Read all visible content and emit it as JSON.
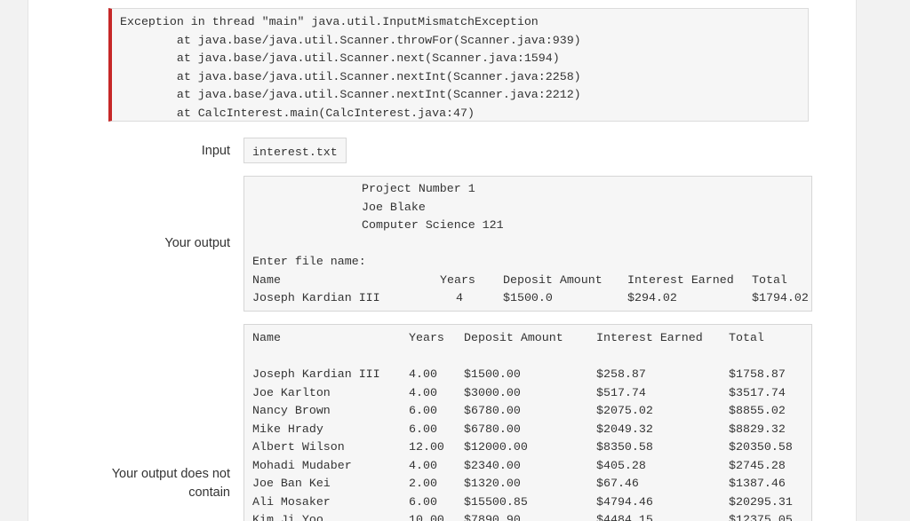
{
  "error": {
    "lines": [
      "Exception in thread \"main\" java.util.InputMismatchException",
      "        at java.base/java.util.Scanner.throwFor(Scanner.java:939)",
      "        at java.base/java.util.Scanner.next(Scanner.java:1594)",
      "        at java.base/java.util.Scanner.nextInt(Scanner.java:2258)",
      "        at java.base/java.util.Scanner.nextInt(Scanner.java:2212)",
      "        at CalcInterest.main(CalcInterest.java:47)"
    ],
    "accent_color": "#c62828"
  },
  "input": {
    "label": "Input",
    "value": "interest.txt"
  },
  "your_output": {
    "label": "Your output",
    "header_lines": [
      "Project Number 1",
      "Joe Blake",
      "Computer Science 121"
    ],
    "prompt": "Enter file name:",
    "table": {
      "columns": [
        "Name",
        "Years",
        "Deposit Amount",
        "Interest Earned",
        "Total"
      ],
      "rows": [
        [
          "Joseph Kardian III",
          "4",
          "$1500.0",
          "$294.02",
          "$1794.02"
        ]
      ]
    }
  },
  "expected_missing": {
    "label": "Your output does not contain",
    "columns": [
      "Name",
      "Years",
      "Deposit Amount",
      "Interest Earned",
      "Total"
    ],
    "rows": [
      [
        "Joseph Kardian III",
        "4.00",
        "$1500.00",
        "$258.87",
        "$1758.87"
      ],
      [
        "Joe Karlton",
        "4.00",
        "$3000.00",
        "$517.74",
        "$3517.74"
      ],
      [
        "Nancy Brown",
        "6.00",
        "$6780.00",
        "$2075.02",
        "$8855.02"
      ],
      [
        "Mike Hrady",
        "6.00",
        "$6780.00",
        "$2049.32",
        "$8829.32"
      ],
      [
        "Albert Wilson",
        "12.00",
        "$12000.00",
        "$8350.58",
        "$20350.58"
      ],
      [
        "Mohadi Mudaber",
        "4.00",
        "$2340.00",
        "$405.28",
        "$2745.28"
      ],
      [
        "Joe Ban Kei",
        "2.00",
        "$1320.00",
        "$67.46",
        "$1387.46"
      ],
      [
        "Ali Mosaker",
        "6.00",
        "$15500.85",
        "$4794.46",
        "$20295.31"
      ],
      [
        "Kim Ji Yoo",
        "10.00",
        "$7890.90",
        "$4484.15",
        "$12375.05"
      ]
    ]
  }
}
